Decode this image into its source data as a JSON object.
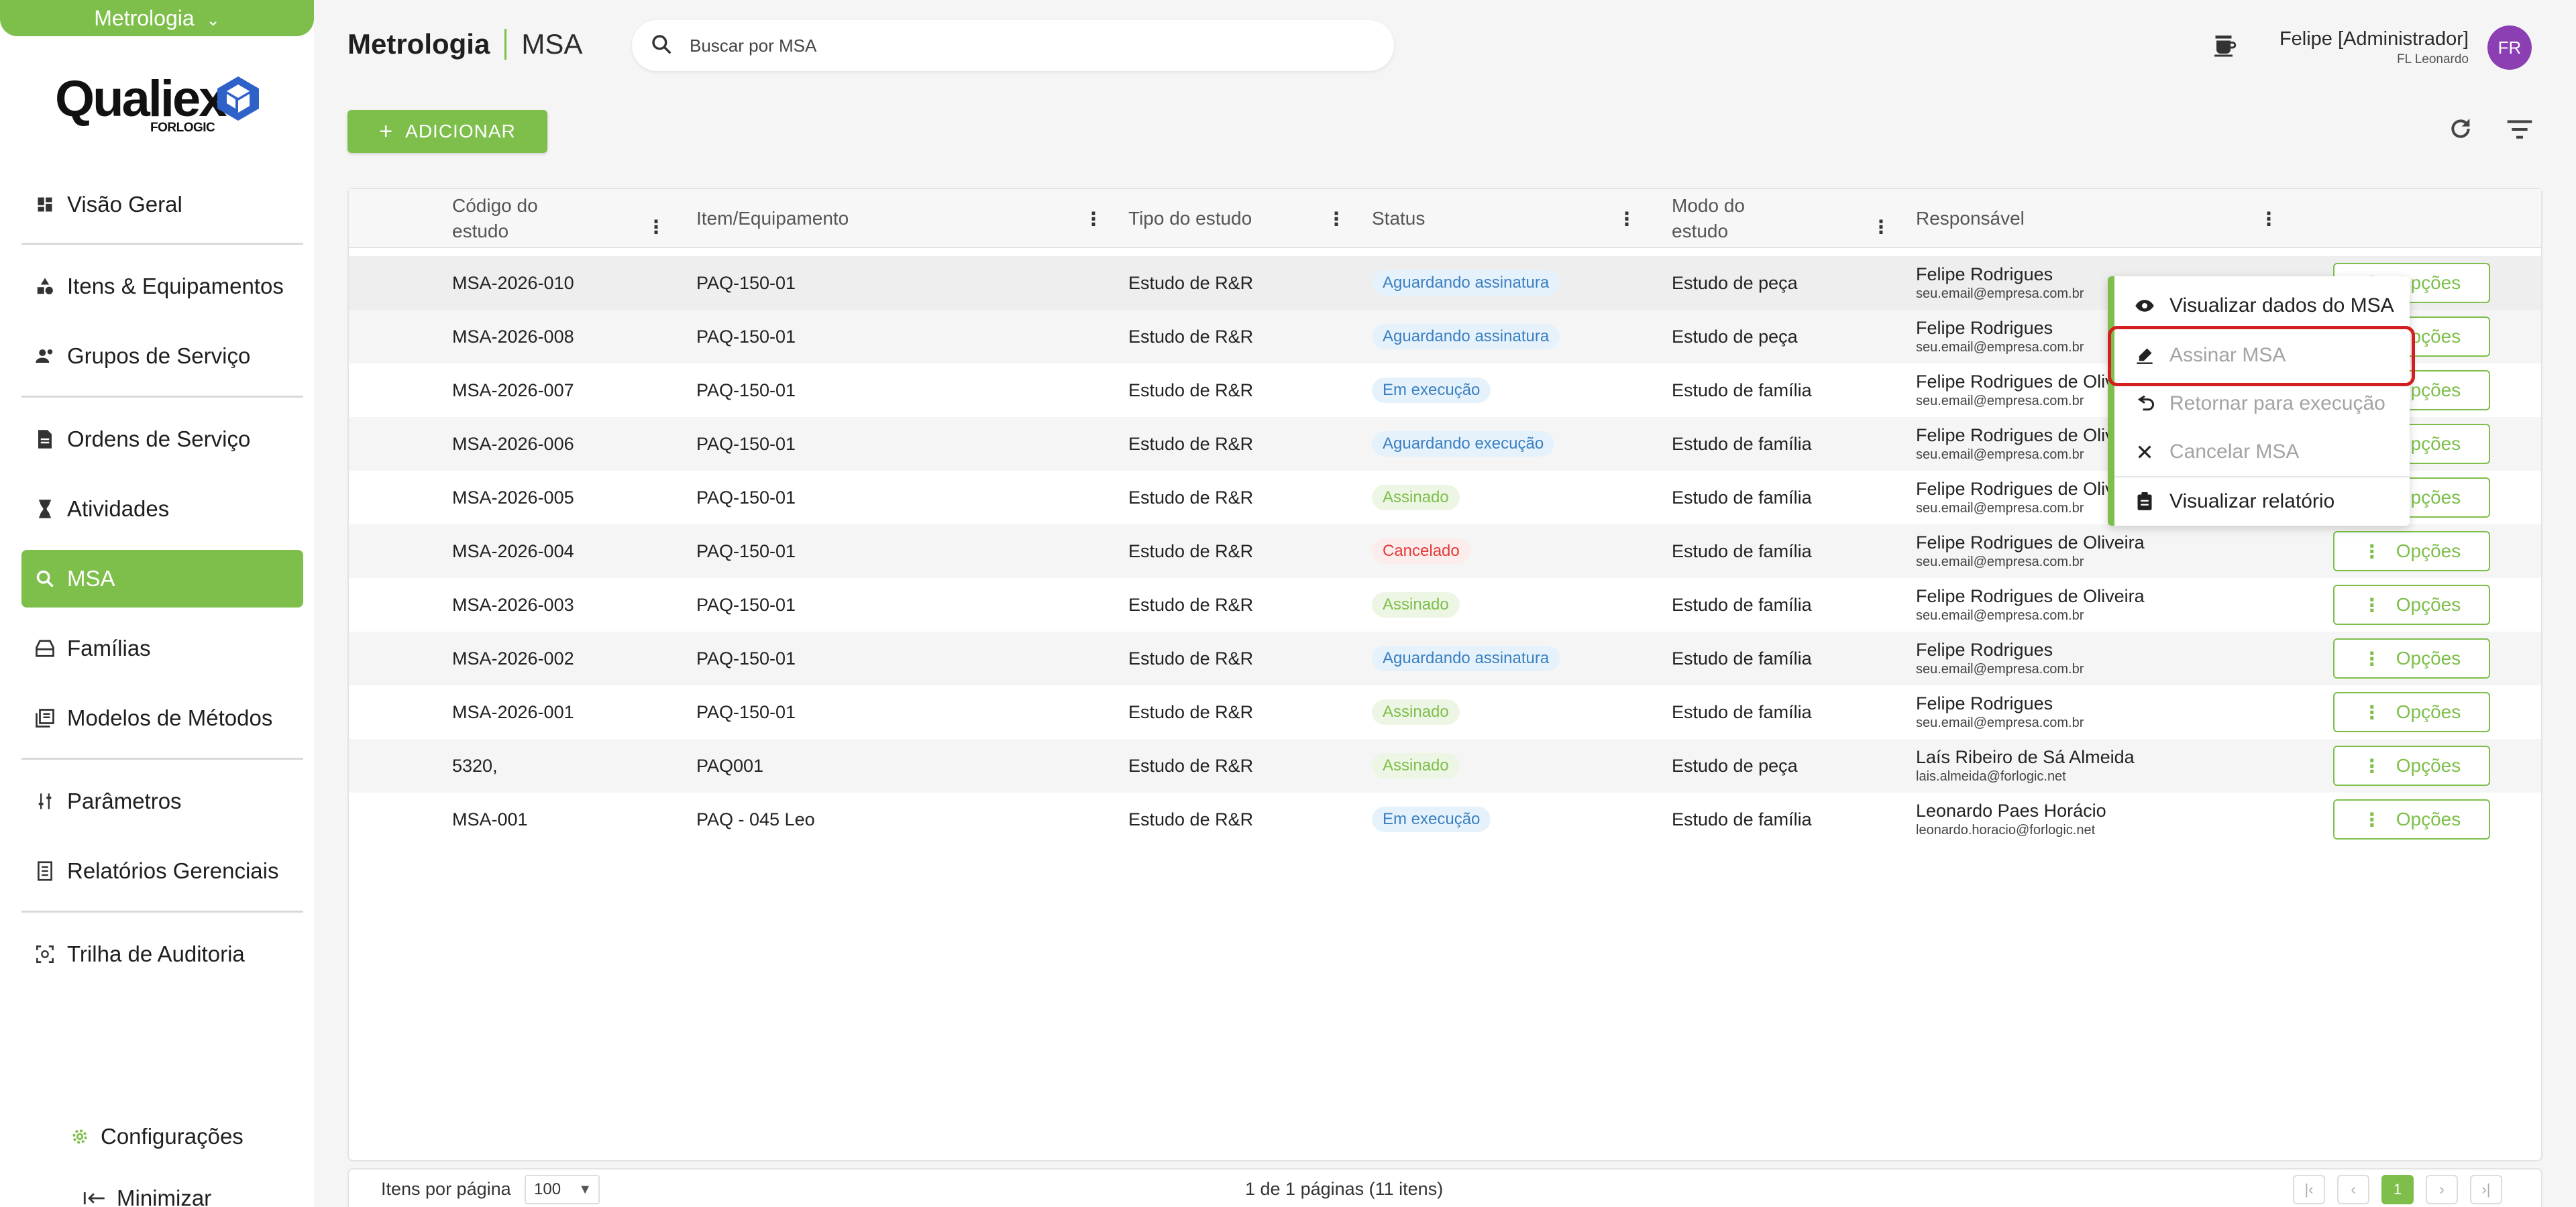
{
  "sidebar": {
    "module": "Metrologia",
    "logo_word": "Qualiex",
    "logo_sub": "FORLOGIC",
    "items": [
      {
        "label": "Visão Geral"
      },
      {
        "label": "Itens & Equipamentos"
      },
      {
        "label": "Grupos de Serviço"
      },
      {
        "label": "Ordens de Serviço"
      },
      {
        "label": "Atividades"
      },
      {
        "label": "MSA"
      },
      {
        "label": "Famílias"
      },
      {
        "label": "Modelos de Métodos"
      },
      {
        "label": "Parâmetros"
      },
      {
        "label": "Relatórios Gerenciais"
      },
      {
        "label": "Trilha de Auditoria"
      }
    ],
    "settings_label": "Configurações",
    "minimize_label": "Minimizar"
  },
  "header": {
    "title": "Metrologia",
    "subtitle": "MSA",
    "search_placeholder": "Buscar por MSA",
    "user_name": "Felipe [Administrador]",
    "user_company": "FL Leonardo",
    "avatar_initials": "FR"
  },
  "toolbar": {
    "add_label": "ADICIONAR"
  },
  "table": {
    "columns": [
      "Código do estudo",
      "Item/Equipamento",
      "Tipo do estudo",
      "Status",
      "Modo do estudo",
      "Responsável"
    ],
    "options_label": "Opções",
    "rows": [
      {
        "code": "MSA-2026-010",
        "item": "PAQ-150-01",
        "type": "Estudo de R&R",
        "status": "Aguardando assinatura",
        "status_color": "blue",
        "mode": "Estudo de peça",
        "resp": "Felipe Rodrigues",
        "email": "seu.email@empresa.com.br"
      },
      {
        "code": "MSA-2026-008",
        "item": "PAQ-150-01",
        "type": "Estudo de R&R",
        "status": "Aguardando assinatura",
        "status_color": "blue",
        "mode": "Estudo de peça",
        "resp": "Felipe Rodrigues",
        "email": "seu.email@empresa.com.br"
      },
      {
        "code": "MSA-2026-007",
        "item": "PAQ-150-01",
        "type": "Estudo de R&R",
        "status": "Em execução",
        "status_color": "blue",
        "mode": "Estudo de família",
        "resp": "Felipe Rodrigues de Oliveira",
        "email": "seu.email@empresa.com.br"
      },
      {
        "code": "MSA-2026-006",
        "item": "PAQ-150-01",
        "type": "Estudo de R&R",
        "status": "Aguardando execução",
        "status_color": "blue",
        "mode": "Estudo de família",
        "resp": "Felipe Rodrigues de Oliveira",
        "email": "seu.email@empresa.com.br"
      },
      {
        "code": "MSA-2026-005",
        "item": "PAQ-150-01",
        "type": "Estudo de R&R",
        "status": "Assinado",
        "status_color": "green",
        "mode": "Estudo de família",
        "resp": "Felipe Rodrigues de Oliveira",
        "email": "seu.email@empresa.com.br"
      },
      {
        "code": "MSA-2026-004",
        "item": "PAQ-150-01",
        "type": "Estudo de R&R",
        "status": "Cancelado",
        "status_color": "red",
        "mode": "Estudo de família",
        "resp": "Felipe Rodrigues de Oliveira",
        "email": "seu.email@empresa.com.br"
      },
      {
        "code": "MSA-2026-003",
        "item": "PAQ-150-01",
        "type": "Estudo de R&R",
        "status": "Assinado",
        "status_color": "green",
        "mode": "Estudo de família",
        "resp": "Felipe Rodrigues de Oliveira",
        "email": "seu.email@empresa.com.br"
      },
      {
        "code": "MSA-2026-002",
        "item": "PAQ-150-01",
        "type": "Estudo de R&R",
        "status": "Aguardando assinatura",
        "status_color": "blue",
        "mode": "Estudo de família",
        "resp": "Felipe Rodrigues",
        "email": "seu.email@empresa.com.br"
      },
      {
        "code": "MSA-2026-001",
        "item": "PAQ-150-01",
        "type": "Estudo de R&R",
        "status": "Assinado",
        "status_color": "green",
        "mode": "Estudo de família",
        "resp": "Felipe Rodrigues",
        "email": "seu.email@empresa.com.br"
      },
      {
        "code": "5320,",
        "item": "PAQ001",
        "type": "Estudo de R&R",
        "status": "Assinado",
        "status_color": "green",
        "mode": "Estudo de peça",
        "resp": "Laís Ribeiro de Sá Almeida",
        "email": "lais.almeida@forlogic.net"
      },
      {
        "code": "MSA-001",
        "item": "PAQ - 045 Leo",
        "type": "Estudo de R&R",
        "status": "Em execução",
        "status_color": "blue",
        "mode": "Estudo de família",
        "resp": "Leonardo Paes Horácio",
        "email": "leonardo.horacio@forlogic.net"
      }
    ]
  },
  "menu": {
    "items": [
      {
        "label": "Visualizar dados do MSA",
        "icon": "eye-icon",
        "disabled": false
      },
      {
        "label": "Assinar MSA",
        "icon": "pen-sign-icon",
        "disabled": true
      },
      {
        "label": "Retornar para execução",
        "icon": "undo-icon",
        "disabled": true
      },
      {
        "label": "Cancelar MSA",
        "icon": "close-icon",
        "disabled": true
      },
      {
        "label": "Visualizar relatório",
        "icon": "report-icon",
        "disabled": false
      }
    ]
  },
  "pagination": {
    "items_per_page_label": "Itens por página",
    "page_size": "100",
    "info": "1 de 1 páginas (11 itens)",
    "current_page": "1"
  },
  "colors": {
    "accent": "#7dbf4a",
    "avatar": "#8b3fb3",
    "status_blue": "#3a7fc1",
    "status_red": "#e23b3b",
    "highlight": "#d21f1f"
  }
}
